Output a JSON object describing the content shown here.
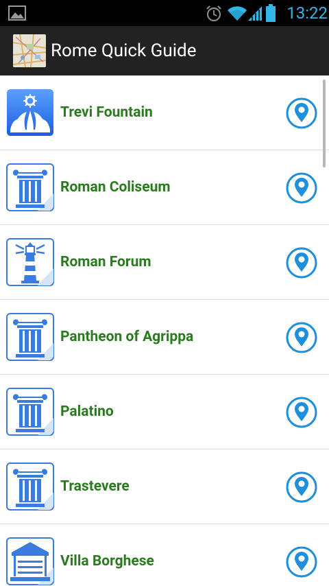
{
  "status_bar": {
    "time": "13:22",
    "icons": [
      "image-notification-icon",
      "alarm-icon",
      "wifi-icon",
      "signal-icon",
      "battery-icon"
    ],
    "accent_color": "#33b5e5"
  },
  "action_bar": {
    "title": "Rome Quick Guide",
    "icon": "map-icon"
  },
  "list": {
    "label_color": "#2a7a1e",
    "items": [
      {
        "label": "Trevi Fountain",
        "icon": "fountain-icon"
      },
      {
        "label": "Roman Coliseum",
        "icon": "column-icon"
      },
      {
        "label": "Roman Forum",
        "icon": "lighthouse-icon"
      },
      {
        "label": "Pantheon of Agrippa",
        "icon": "column-icon"
      },
      {
        "label": "Palatino",
        "icon": "column-icon"
      },
      {
        "label": "Trastevere",
        "icon": "column-icon"
      },
      {
        "label": "Villa Borghese",
        "icon": "pavilion-icon"
      }
    ]
  }
}
